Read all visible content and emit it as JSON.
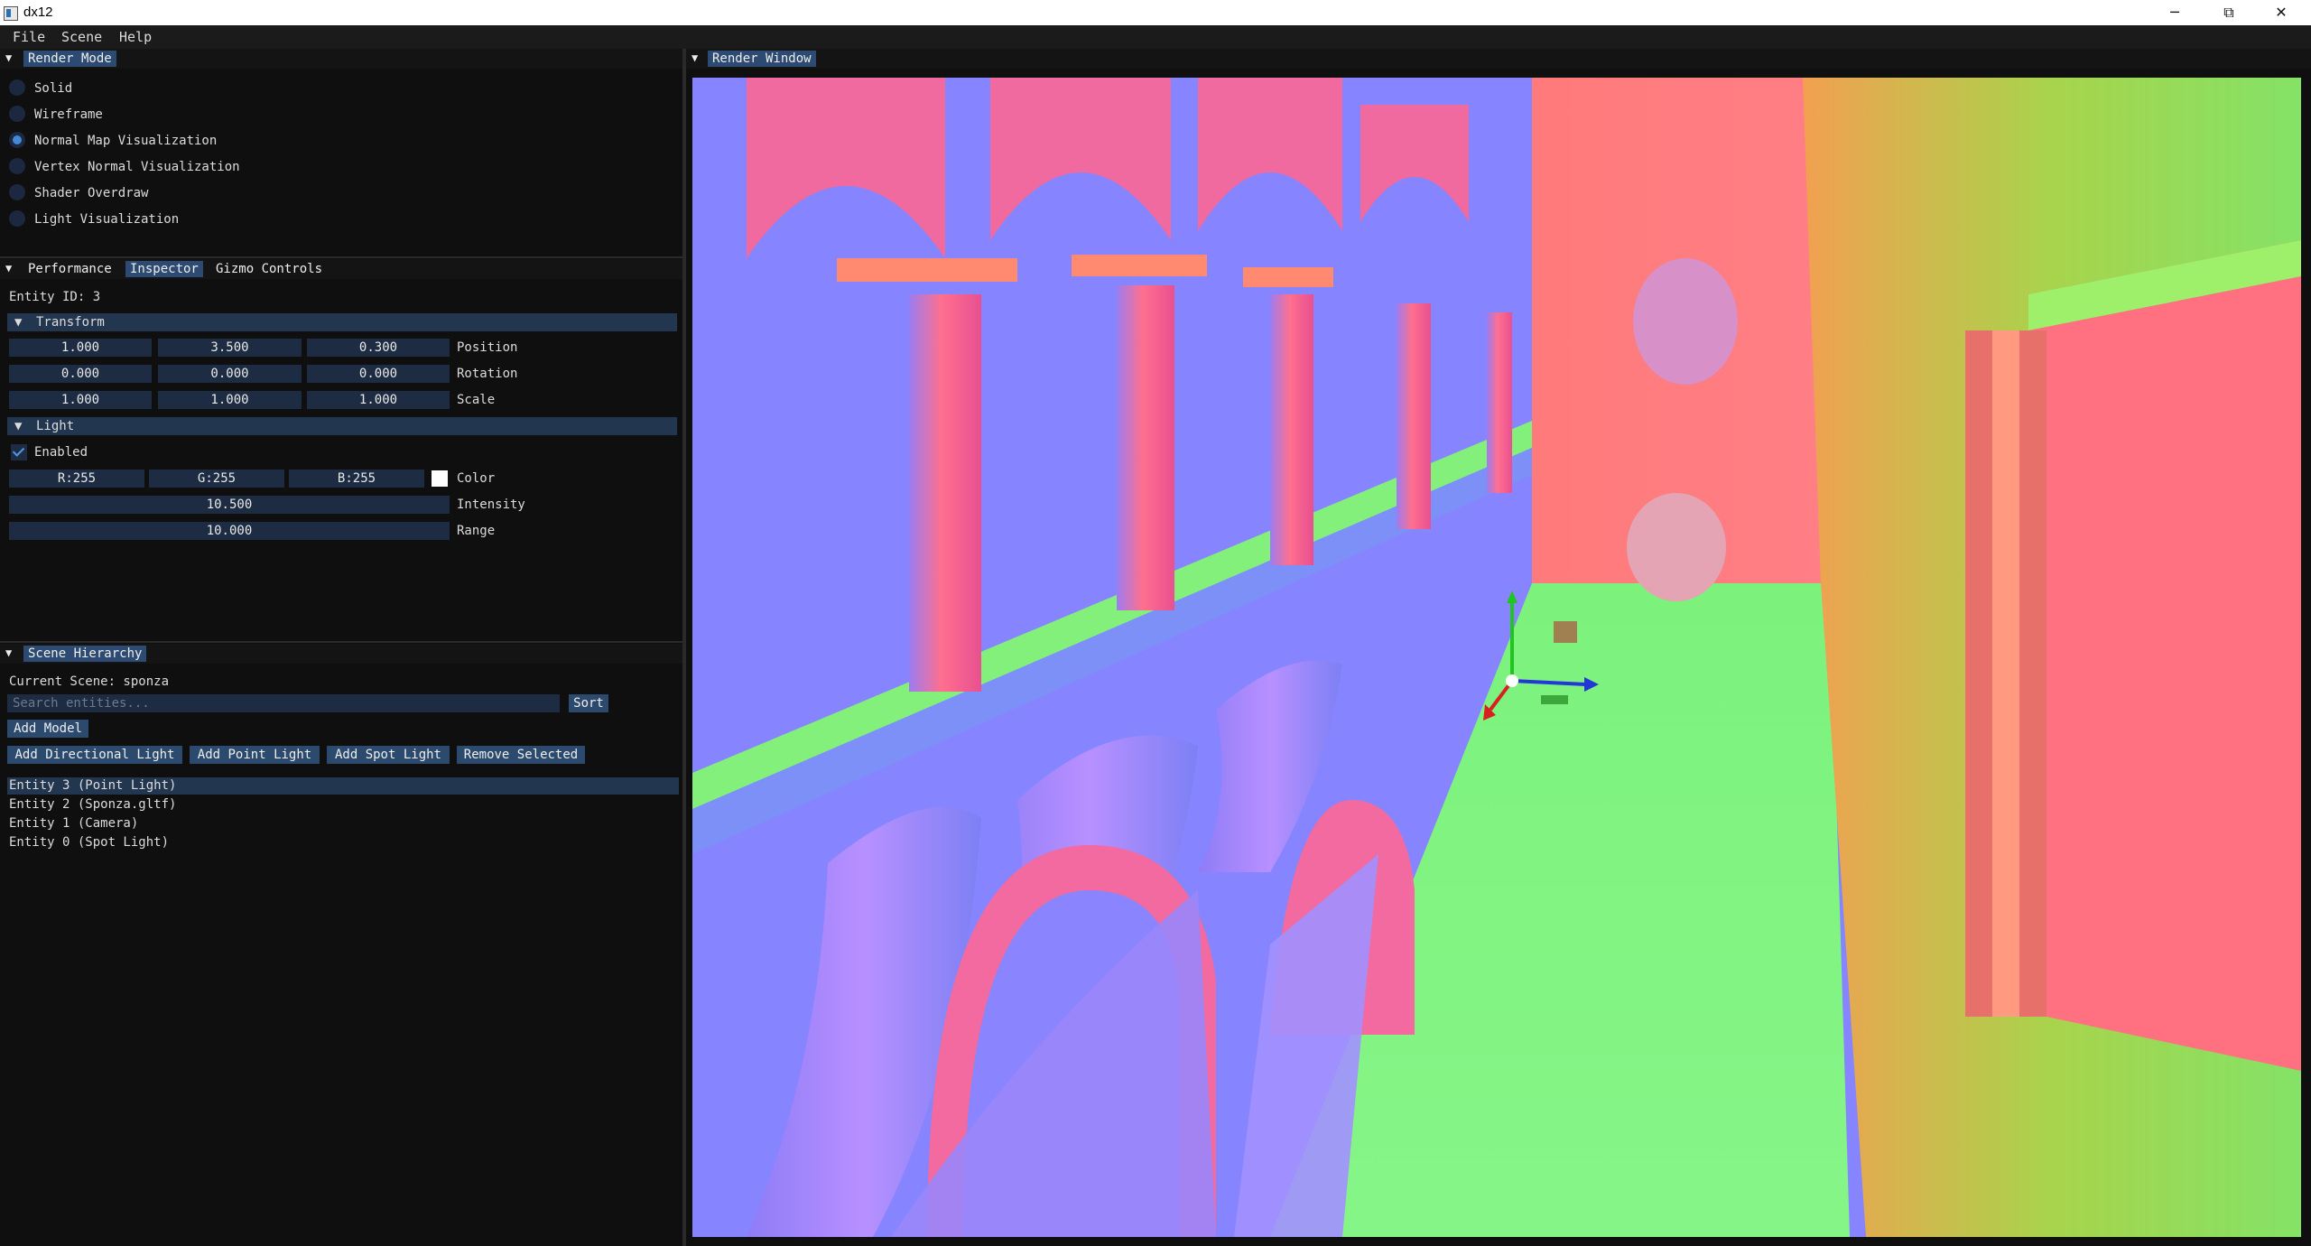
{
  "window": {
    "title": "dx12",
    "minimize": "─",
    "maximize": "⧉",
    "close": "✕"
  },
  "menubar": [
    "File",
    "Scene",
    "Help"
  ],
  "render_mode": {
    "title": "Render Mode",
    "options": [
      {
        "label": "Solid",
        "selected": false
      },
      {
        "label": "Wireframe",
        "selected": false
      },
      {
        "label": "Normal Map Visualization",
        "selected": true
      },
      {
        "label": "Vertex Normal Visualization",
        "selected": false
      },
      {
        "label": "Shader Overdraw",
        "selected": false
      },
      {
        "label": "Light Visualization",
        "selected": false
      }
    ]
  },
  "inspector": {
    "tabs": [
      "Performance",
      "Inspector",
      "Gizmo Controls"
    ],
    "active_tab": "Inspector",
    "entity_id": "Entity ID: 3",
    "transform": {
      "header": "Transform",
      "position": {
        "values": [
          "1.000",
          "3.500",
          "0.300"
        ],
        "label": "Position"
      },
      "rotation": {
        "values": [
          "0.000",
          "0.000",
          "0.000"
        ],
        "label": "Rotation"
      },
      "scale": {
        "values": [
          "1.000",
          "1.000",
          "1.000"
        ],
        "label": "Scale"
      }
    },
    "light": {
      "header": "Light",
      "enabled_label": "Enabled",
      "enabled": true,
      "color": {
        "r": "R:255",
        "g": "G:255",
        "b": "B:255",
        "label": "Color",
        "swatch": "#ffffff"
      },
      "intensity": {
        "value": "10.500",
        "label": "Intensity"
      },
      "range": {
        "value": "10.000",
        "label": "Range"
      }
    }
  },
  "hierarchy": {
    "title": "Scene Hierarchy",
    "current_scene": "Current Scene: sponza",
    "search_placeholder": "Search entities...",
    "sort_label": "Sort",
    "add_model": "Add Model",
    "buttons": [
      "Add Directional Light",
      "Add Point Light",
      "Add Spot Light",
      "Remove Selected"
    ],
    "entities": [
      {
        "label": "Entity 3 (Point Light)",
        "selected": true
      },
      {
        "label": "Entity 2 (Sponza.gltf)",
        "selected": false
      },
      {
        "label": "Entity 1 (Camera)",
        "selected": false
      },
      {
        "label": "Entity 0 (Spot Light)",
        "selected": false
      }
    ]
  },
  "render_window": {
    "title": "Render Window"
  },
  "colors": {
    "accent": "#2c4a72",
    "field": "#1d2c42",
    "checkmark": "#4f98e3",
    "panel_bg": "#0f0f0f"
  }
}
